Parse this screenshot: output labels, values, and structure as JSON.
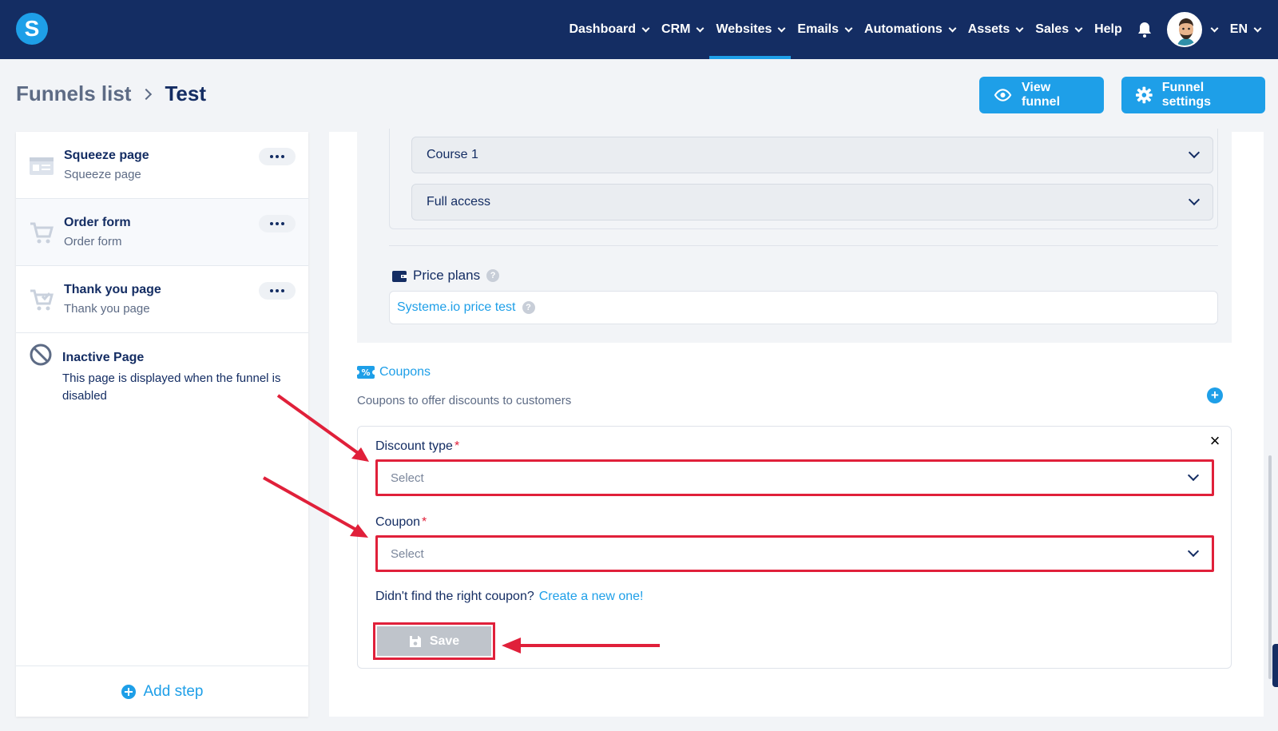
{
  "app": {
    "logo_letter": "S"
  },
  "nav": {
    "items": [
      {
        "label": "Dashboard",
        "dropdown": true,
        "active": false
      },
      {
        "label": "CRM",
        "dropdown": true,
        "active": false
      },
      {
        "label": "Websites",
        "dropdown": true,
        "active": true
      },
      {
        "label": "Emails",
        "dropdown": true,
        "active": false
      },
      {
        "label": "Automations",
        "dropdown": true,
        "active": false
      },
      {
        "label": "Assets",
        "dropdown": true,
        "active": false
      },
      {
        "label": "Sales",
        "dropdown": true,
        "active": false
      },
      {
        "label": "Help",
        "dropdown": false,
        "active": false
      }
    ],
    "language": "EN"
  },
  "breadcrumb": {
    "parent": "Funnels list",
    "current": "Test"
  },
  "header_buttons": {
    "view_funnel": "View funnel",
    "funnel_settings": "Funnel settings"
  },
  "steps": [
    {
      "title": "Squeeze page",
      "subtitle": "Squeeze page",
      "icon": "page-icon"
    },
    {
      "title": "Order form",
      "subtitle": "Order form",
      "icon": "cart-icon"
    },
    {
      "title": "Thank you page",
      "subtitle": "Thank you page",
      "icon": "cart-check-icon"
    }
  ],
  "inactive_page": {
    "title": "Inactive Page",
    "description": "This page is displayed when the funnel is disabled"
  },
  "add_step": "Add step",
  "product": {
    "course": "Course 1",
    "access": "Full access"
  },
  "price_plans": {
    "label": "Price plans",
    "value": "Systeme.io price test"
  },
  "coupons": {
    "title": "Coupons",
    "description": "Coupons to offer discounts to customers",
    "discount_type_label": "Discount type",
    "discount_type_placeholder": "Select",
    "coupon_label": "Coupon",
    "coupon_placeholder": "Select",
    "required_mark": "*",
    "hint_text": "Didn't find the right coupon?",
    "hint_link": "Create a new one!",
    "save": "Save",
    "close": "×",
    "add": "+"
  },
  "colors": {
    "nav_bg": "#142d63",
    "accent": "#1e9fe8",
    "annotation_red": "#e0203a",
    "disabled_button": "#bfc4cb"
  }
}
